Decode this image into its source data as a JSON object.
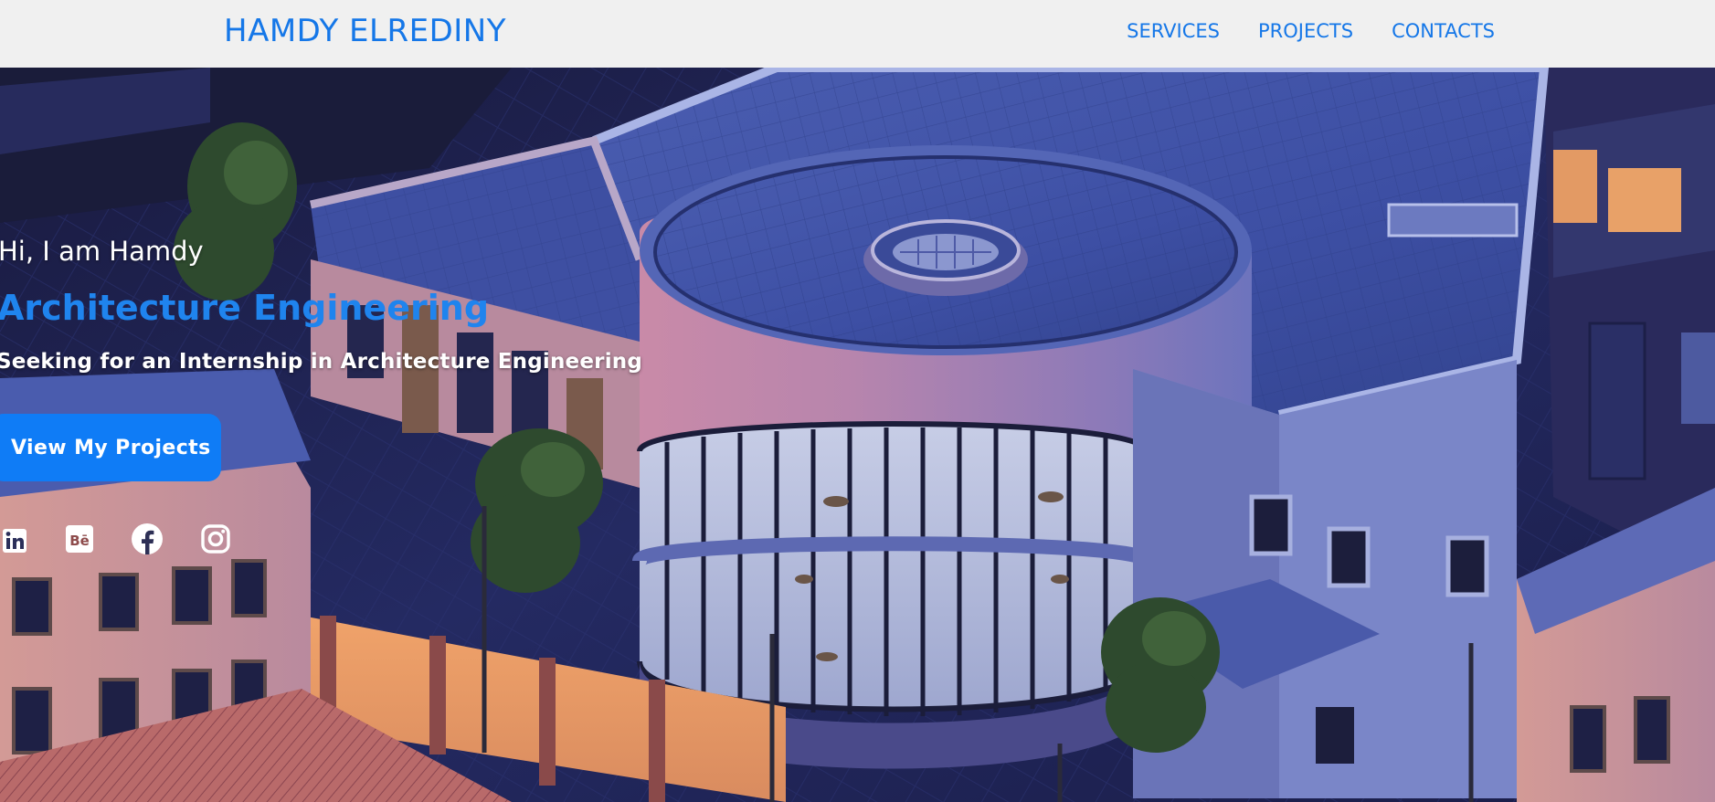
{
  "header": {
    "brand": "HAMDY ELREDINY",
    "nav": [
      {
        "label": "SERVICES"
      },
      {
        "label": "PROJECTS"
      },
      {
        "label": "CONTACTS"
      }
    ]
  },
  "hero": {
    "greeting": "Hi, I am Hamdy",
    "role": "Architecture Engineering",
    "tagline": "Seeking for an Internship in Architecture Engineering",
    "cta_label": "View My Projects",
    "socials": [
      {
        "icon": "linkedin-icon"
      },
      {
        "icon": "behance-icon",
        "text": "Bē"
      },
      {
        "icon": "facebook-icon"
      },
      {
        "icon": "instagram-icon"
      }
    ]
  },
  "colors": {
    "accent": "#1577e8",
    "button": "#0f7cf6",
    "nav_bg": "#f0f0f0"
  }
}
